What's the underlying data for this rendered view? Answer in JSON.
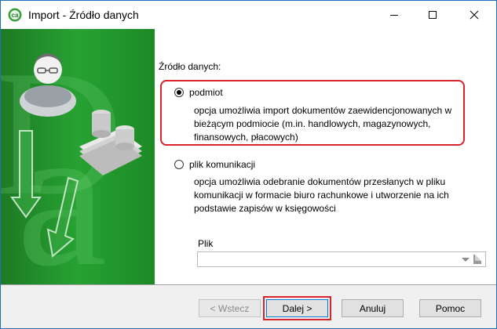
{
  "window": {
    "title": "Import - Źródło danych",
    "min_symbol": "—",
    "max_symbol": "☐",
    "close_symbol": "✕"
  },
  "main": {
    "source_label": "Źródło danych:",
    "options": [
      {
        "label": "podmiot",
        "checked": true,
        "description": "opcja umożliwia import dokumentów zaewidencjonowanych w bieżącym podmiocie (m.in. handlowych, magazynowych, finansowych, płacowych)"
      },
      {
        "label": "plik komunikacji",
        "checked": false,
        "description": "opcja umożliwia odebranie dokumentów przesłanych w pliku komunikacji w formacie biuro rachunkowe i utworzenie na ich podstawie zapisów w księgowości"
      }
    ],
    "file_label": "Plik",
    "file_value": ""
  },
  "buttons": {
    "back": "< Wstecz",
    "next": "Dalej >",
    "cancel": "Anuluj",
    "help": "Pomoc"
  },
  "colors": {
    "highlight": "#d9232d",
    "sidebar_green": "#1f8c2a",
    "title_border": "#1c6fb8"
  },
  "icons": {
    "app": "app-logo-icon",
    "user": "user-avatar-icon",
    "coins": "coins-stack-icon",
    "arrows": "import-arrow-icon"
  }
}
